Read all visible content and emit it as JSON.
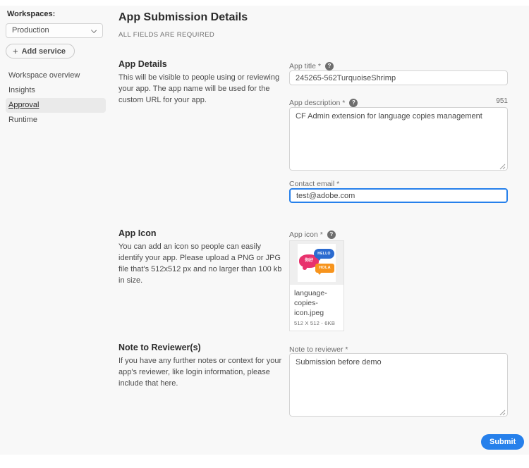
{
  "sidebar": {
    "workspaces_label": "Workspaces:",
    "workspace_selected": "Production",
    "add_service_label": "Add service",
    "nav": [
      {
        "label": "Workspace overview",
        "active": false
      },
      {
        "label": "Insights",
        "active": false
      },
      {
        "label": "Approval",
        "active": true
      },
      {
        "label": "Runtime",
        "active": false
      }
    ]
  },
  "header": {
    "title": "App Submission Details",
    "subtitle": "ALL FIELDS ARE REQUIRED"
  },
  "sections": {
    "app_details": {
      "heading": "App Details",
      "description": "This will be visible to people using or reviewing your app. The app name will be used for the custom URL for your app.",
      "fields": {
        "app_title": {
          "label": "App title *",
          "value": "245265-562TurquoiseShrimp"
        },
        "app_description": {
          "label": "App description *",
          "value": "CF Admin extension for language copies management",
          "char_counter": "951"
        },
        "contact_email": {
          "label": "Contact email *",
          "value": "test@adobe.com"
        }
      }
    },
    "app_icon": {
      "heading": "App Icon",
      "description": "You can add an icon so people can easily identify your app. Please upload a PNG or JPG file that's 512x512 px and no larger than 100 kb in size.",
      "field_label": "App icon *",
      "file_name": "language-copies-icon.jpeg",
      "file_meta": "512 X 512 - 6KB",
      "preview_bubbles": {
        "pink": "你好",
        "blue": "HELLO",
        "orange": "HOLA"
      }
    },
    "note_to_reviewer": {
      "heading": "Note to Reviewer(s)",
      "description": "If you have any further notes or context for your app's reviewer, like login information, please include that here.",
      "field_label": "Note to reviewer *",
      "value": "Submission before demo"
    }
  },
  "footer": {
    "submit_label": "Submit"
  },
  "icons": {
    "help_glyph": "?",
    "plus_glyph": "+"
  },
  "colors": {
    "accent_blue": "#2680eb",
    "page_background": "#f8f8f8",
    "input_border": "#d3d3d3",
    "selected_nav_bg": "#eaeaea",
    "bubble_pink": "#e8326d",
    "bubble_blue": "#2b6bd0",
    "bubble_orange": "#f7941d"
  }
}
